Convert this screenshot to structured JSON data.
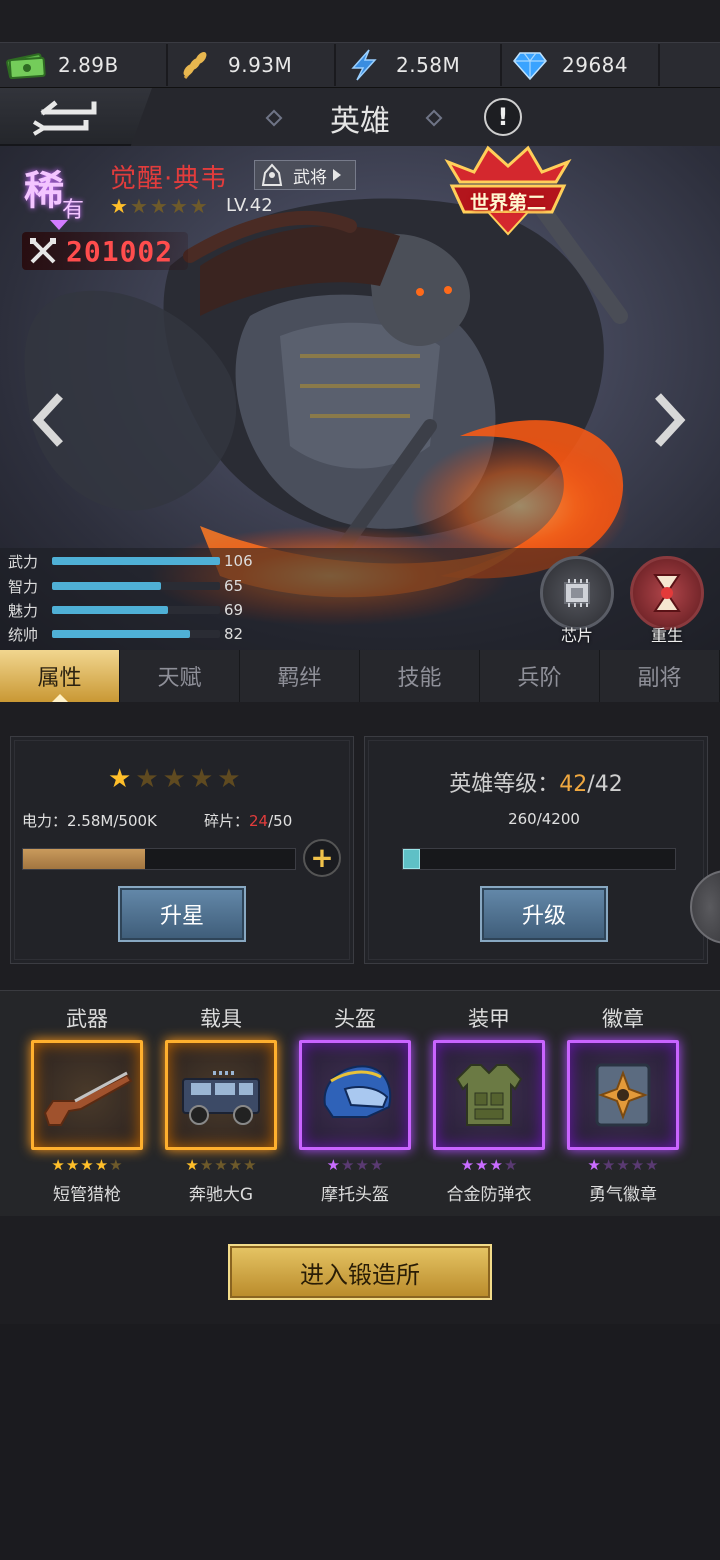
{
  "resources": [
    {
      "icon": "cash-icon",
      "value": "2.89B"
    },
    {
      "icon": "wheat-icon",
      "value": "9.93M"
    },
    {
      "icon": "lightning-icon",
      "value": "2.58M"
    },
    {
      "icon": "diamond-icon",
      "value": "29684"
    }
  ],
  "header": {
    "title": "英雄",
    "info_label": "!"
  },
  "hero": {
    "rarity": "稀",
    "rarity_sub": "有",
    "name": "觉醒·典韦",
    "class": "武将",
    "stars": 5,
    "stars_filled": 1,
    "level": "LV.42",
    "power": "201002",
    "badge": "世界第二",
    "stats": [
      {
        "label": "武力",
        "value": "106",
        "fill": 1.0
      },
      {
        "label": "智力",
        "value": "65",
        "fill": 0.65
      },
      {
        "label": "魅力",
        "value": "69",
        "fill": 0.69
      },
      {
        "label": "统帅",
        "value": "82",
        "fill": 0.82
      }
    ],
    "chip_label": "芯片",
    "rebirth_label": "重生"
  },
  "tabs": [
    "属性",
    "天赋",
    "羁绊",
    "技能",
    "兵阶",
    "副将"
  ],
  "star_panel": {
    "stars": 5,
    "stars_filled": 1,
    "power_label": "电力：2.58M/500K",
    "shard_label": "碎片：",
    "shard_current": "24",
    "shard_total": "/50",
    "progress": 0.45,
    "button": "升星"
  },
  "level_panel": {
    "label": "英雄等级：",
    "level": "42",
    "max": "/42",
    "exp": "260/4200",
    "progress": 0.062,
    "button": "升级"
  },
  "equipment": [
    {
      "slot": "武器",
      "name": "短管猎枪",
      "quality": "gold",
      "stars_filled": 4,
      "stars": 5
    },
    {
      "slot": "载具",
      "name": "奔驰大G",
      "quality": "gold",
      "stars_filled": 1,
      "stars": 5
    },
    {
      "slot": "头盔",
      "name": "摩托头盔",
      "quality": "purple",
      "stars_filled": 1,
      "stars": 4
    },
    {
      "slot": "装甲",
      "name": "合金防弹衣",
      "quality": "purple",
      "stars_filled": 3,
      "stars": 4
    },
    {
      "slot": "徽章",
      "name": "勇气徽章",
      "quality": "purple",
      "stars_filled": 1,
      "stars": 5
    }
  ],
  "forge_button": "进入锻造所",
  "colors": {
    "accent_gold": "#f1d68f",
    "stat_bar": "#4fb0d6",
    "power_red": "#ff4d4d",
    "shard_red": "#e23c3c"
  }
}
